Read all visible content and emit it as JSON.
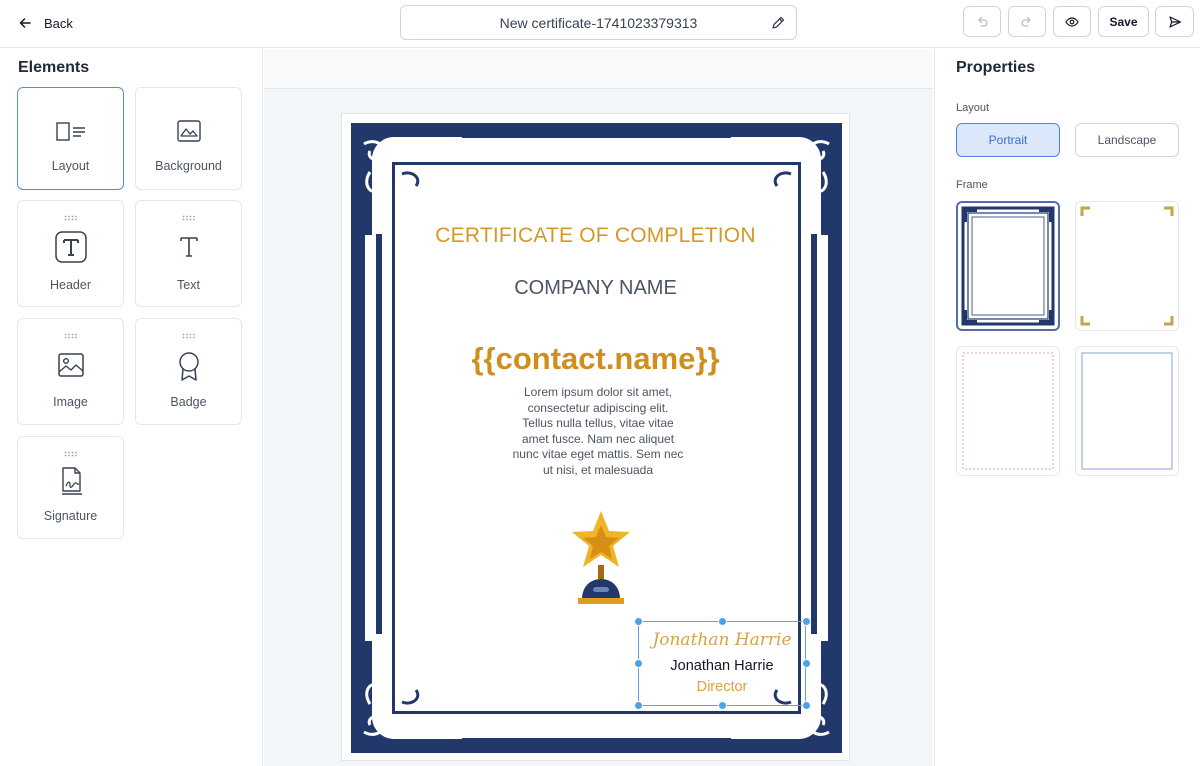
{
  "topbar": {
    "back_label": "Back",
    "document_title": "New certificate-1741023379313",
    "save_label": "Save"
  },
  "elements_panel": {
    "title": "Elements",
    "items": [
      {
        "label": "Layout",
        "icon": "layout-icon",
        "active": true
      },
      {
        "label": "Background",
        "icon": "background-image-icon"
      },
      {
        "label": "Header",
        "icon": "header-text-icon"
      },
      {
        "label": "Text",
        "icon": "text-icon"
      },
      {
        "label": "Image",
        "icon": "image-icon"
      },
      {
        "label": "Badge",
        "icon": "badge-icon"
      },
      {
        "label": "Signature",
        "icon": "signature-icon"
      }
    ]
  },
  "certificate": {
    "title": "CERTIFICATE OF COMPLETION",
    "company": "COMPANY NAME",
    "recipient": "{{contact.name}}",
    "body_lines": [
      "Lorem ipsum dolor sit amet,",
      "consectetur adipiscing elit.",
      "Tellus nulla tellus, vitae vitae",
      "amet fusce. Nam nec aliquet",
      "nunc vitae eget mattis. Sem nec",
      "ut nisi, et malesuada"
    ],
    "signature_script": "Jonathan Harrie",
    "signer_name": "Jonathan Harrie",
    "signer_role": "Director",
    "colors": {
      "frame": "#22386b",
      "gold": "#d4982a",
      "selection": "#4aa3ea"
    }
  },
  "properties_panel": {
    "title": "Properties",
    "layout_label": "Layout",
    "layout_options": [
      "Portrait",
      "Landscape"
    ],
    "selected_layout": "Portrait",
    "frame_label": "Frame",
    "frames": [
      "ornate-navy",
      "gold-corners",
      "dotted-red",
      "thin-blue"
    ],
    "selected_frame": "ornate-navy"
  }
}
